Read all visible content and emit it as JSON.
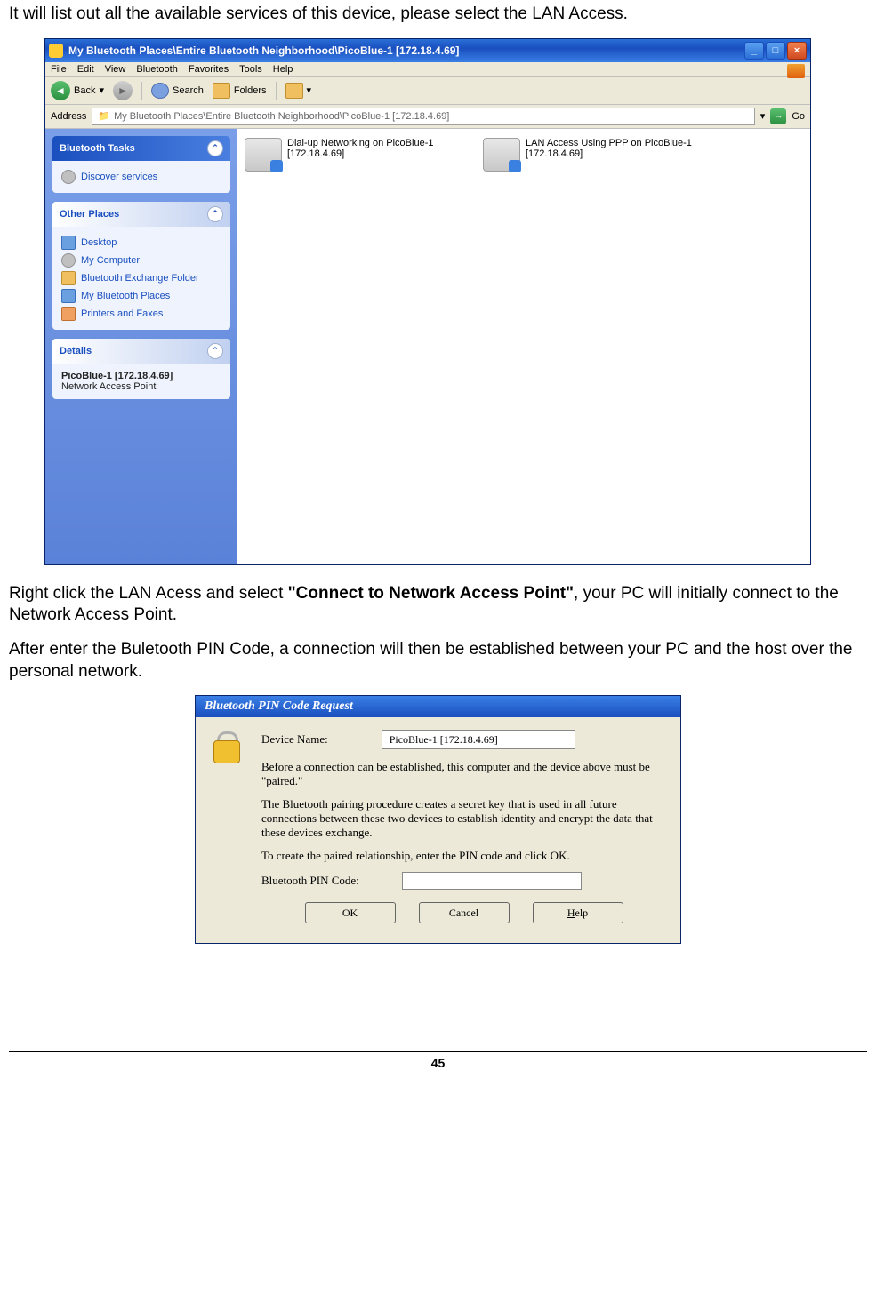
{
  "doc": {
    "intro": "It will list out all the available services of this device, please select the LAN Access.",
    "para2a": "Right click the LAN Acess and select ",
    "para2b": "\"Connect to Network Access Point\"",
    "para2c": ", your PC will initially connect to the Network Access Point.",
    "para3": "After enter the Buletooth PIN Code, a connection will then be established between your PC and the host over the personal network.",
    "page_number": "45"
  },
  "explorer": {
    "title": "My Bluetooth Places\\Entire Bluetooth Neighborhood\\PicoBlue-1 [172.18.4.69]",
    "menu": {
      "file": "File",
      "edit": "Edit",
      "view": "View",
      "bluetooth": "Bluetooth",
      "favorites": "Favorites",
      "tools": "Tools",
      "help": "Help"
    },
    "toolbar": {
      "back": "Back",
      "search": "Search",
      "folders": "Folders"
    },
    "address": {
      "label": "Address",
      "path": "My Bluetooth Places\\Entire Bluetooth Neighborhood\\PicoBlue-1 [172.18.4.69]",
      "go": "Go"
    },
    "sidebar": {
      "tasks_header": "Bluetooth Tasks",
      "tasks": {
        "discover": "Discover services"
      },
      "places_header": "Other Places",
      "places": {
        "desktop": "Desktop",
        "mycomputer": "My Computer",
        "exchange": "Bluetooth Exchange Folder",
        "btplaces": "My Bluetooth Places",
        "printers": "Printers and Faxes"
      },
      "details_header": "Details",
      "details": {
        "name": "PicoBlue-1 [172.18.4.69]",
        "type": "Network Access Point"
      }
    },
    "services": {
      "dialup": {
        "line1": "Dial-up Networking on PicoBlue-1",
        "line2": "[172.18.4.69]"
      },
      "lan": {
        "line1": "LAN Access Using PPP on PicoBlue-1",
        "line2": "[172.18.4.69]"
      }
    }
  },
  "dialog": {
    "title": "Bluetooth PIN Code Request",
    "device_label": "Device Name:",
    "device_value": "PicoBlue-1 [172.18.4.69]",
    "msg1": "Before a connection can be established, this computer and the device above must be \"paired.\"",
    "msg2": "The Bluetooth pairing procedure creates a secret key that is used in all future connections between these two devices to establish identity and encrypt the data that these devices exchange.",
    "msg3": "To create the paired relationship, enter the PIN code and click OK.",
    "pin_label": "Bluetooth PIN Code:",
    "buttons": {
      "ok": "OK",
      "cancel": "Cancel",
      "help": "elp",
      "help_u": "H"
    }
  }
}
